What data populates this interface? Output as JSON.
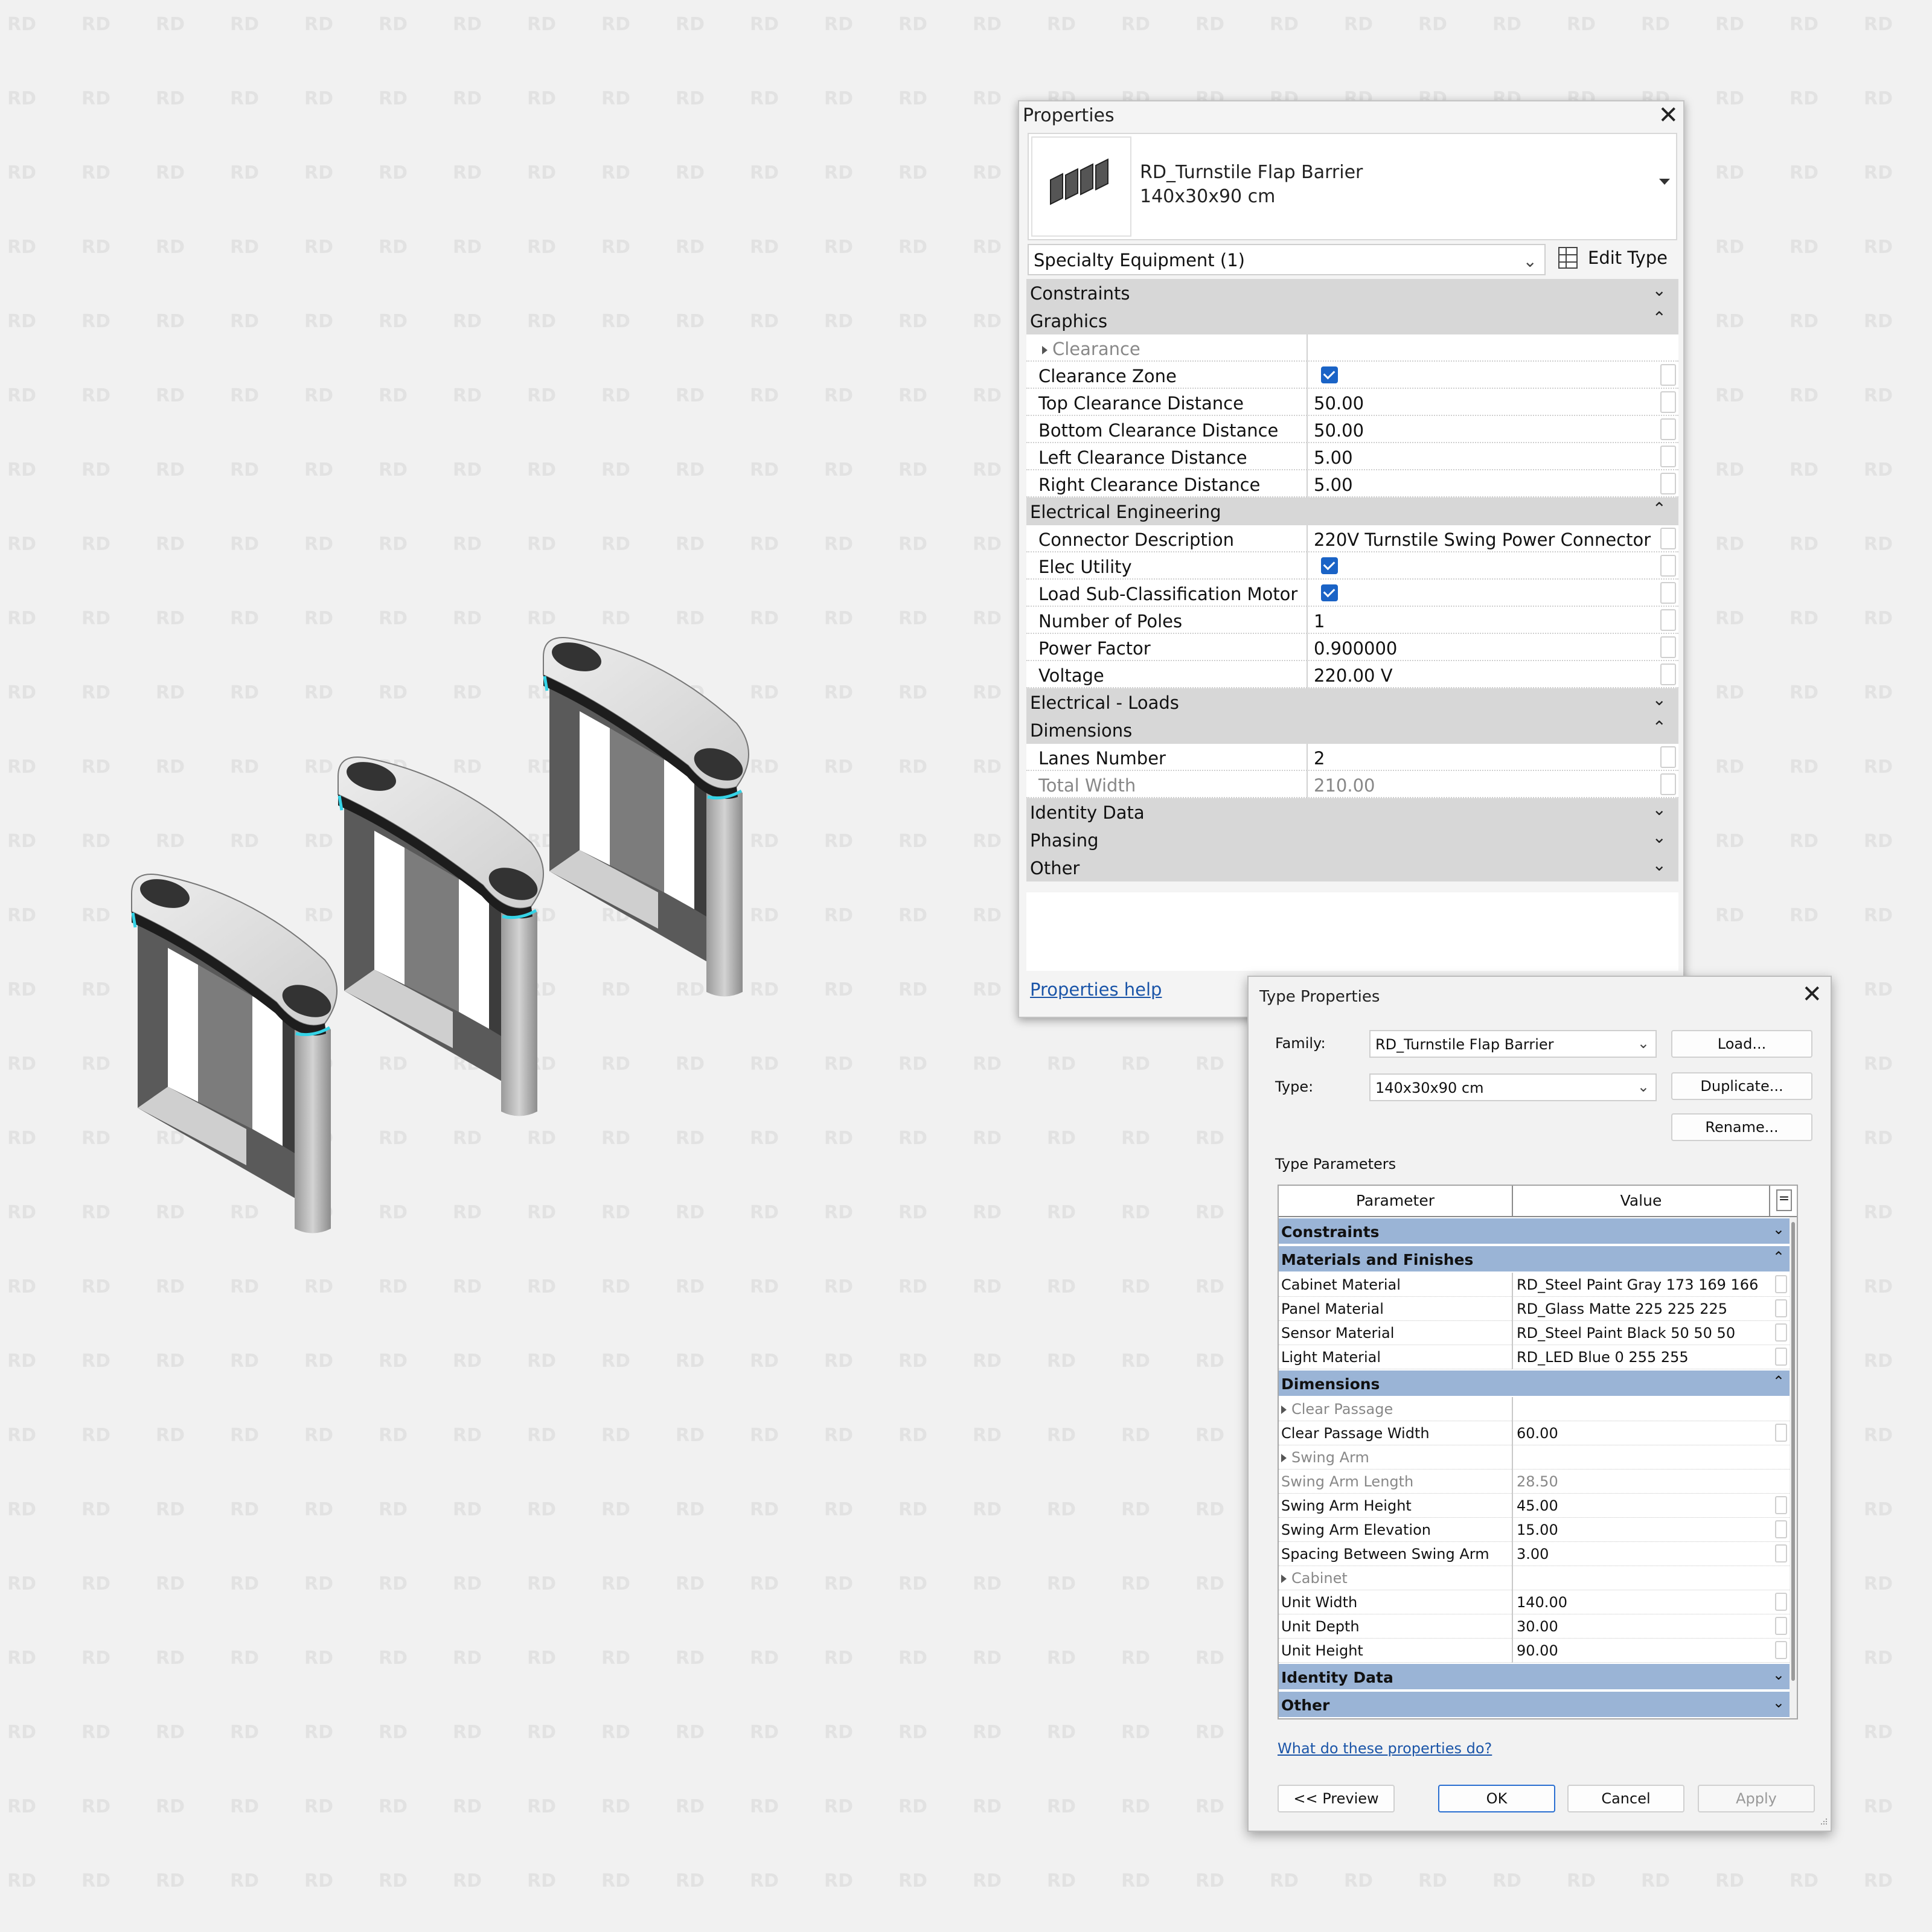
{
  "watermark": "RD",
  "colors": {
    "accent": "#1a63c6",
    "group_blue": "#9ab4d6",
    "link": "#1b55a8",
    "led": "#35d3e6"
  },
  "properties": {
    "title": "Properties",
    "type_name": "RD_Turnstile Flap Barrier",
    "type_size": "140x30x90 cm",
    "instance_filter": "Specialty Equipment (1)",
    "edit_type": "Edit Type",
    "help_link": "Properties help",
    "groups": {
      "constraints": "Constraints",
      "graphics": "Graphics",
      "electrical_engineering": "Electrical Engineering",
      "electrical_loads": "Electrical - Loads",
      "dimensions": "Dimensions",
      "identity_data": "Identity Data",
      "phasing": "Phasing",
      "other": "Other"
    },
    "params": {
      "clearance": {
        "name": "Clearance"
      },
      "clearance_zone": {
        "name": "Clearance Zone",
        "checked": true
      },
      "top_clearance": {
        "name": "Top Clearance Distance",
        "value": "50.00"
      },
      "bottom_clearance": {
        "name": "Bottom Clearance Distance",
        "value": "50.00"
      },
      "left_clearance": {
        "name": "Left Clearance Distance",
        "value": "5.00"
      },
      "right_clearance": {
        "name": "Right Clearance Distance",
        "value": "5.00"
      },
      "connector_desc": {
        "name": "Connector Description",
        "value": "220V Turnstile Swing Power Connector"
      },
      "elec_utility": {
        "name": "Elec Utility",
        "checked": true
      },
      "load_sub_motor": {
        "name": "Load Sub-Classification Motor",
        "checked": true
      },
      "num_poles": {
        "name": "Number of Poles",
        "value": "1"
      },
      "power_factor": {
        "name": "Power Factor",
        "value": "0.900000"
      },
      "voltage": {
        "name": "Voltage",
        "value": "220.00 V"
      },
      "lanes_number": {
        "name": "Lanes Number",
        "value": "2"
      },
      "total_width": {
        "name": "Total Width",
        "value": "210.00"
      }
    }
  },
  "type_properties": {
    "title": "Type Properties",
    "family_label": "Family:",
    "family_value": "RD_Turnstile Flap Barrier",
    "type_label": "Type:",
    "type_value": "140x30x90 cm",
    "load_btn": "Load...",
    "duplicate_btn": "Duplicate...",
    "rename_btn": "Rename...",
    "type_params_label": "Type Parameters",
    "col_parameter": "Parameter",
    "col_value": "Value",
    "col_eq": "=",
    "groups": {
      "constraints": "Constraints",
      "materials": "Materials and Finishes",
      "dimensions": "Dimensions",
      "identity_data": "Identity Data",
      "other": "Other"
    },
    "params": {
      "cabinet_material": {
        "name": "Cabinet Material",
        "value": "RD_Steel Paint Gray 173 169 166"
      },
      "panel_material": {
        "name": "Panel Material",
        "value": "RD_Glass Matte 225 225 225"
      },
      "sensor_material": {
        "name": "Sensor Material",
        "value": "RD_Steel Paint Black 50 50 50"
      },
      "light_material": {
        "name": "Light Material",
        "value": "RD_LED Blue 0 255 255"
      },
      "clear_passage": {
        "name": "Clear Passage"
      },
      "clear_passage_width": {
        "name": "Clear Passage Width",
        "value": "60.00"
      },
      "swing_arm": {
        "name": "Swing Arm"
      },
      "swing_arm_length": {
        "name": "Swing Arm Length",
        "value": "28.50"
      },
      "swing_arm_height": {
        "name": "Swing Arm Height",
        "value": "45.00"
      },
      "swing_arm_elevation": {
        "name": "Swing Arm Elevation",
        "value": "15.00"
      },
      "spacing_between": {
        "name": "Spacing Between Swing Arm",
        "value": "3.00"
      },
      "cabinet": {
        "name": "Cabinet"
      },
      "unit_width": {
        "name": "Unit Width",
        "value": "140.00"
      },
      "unit_depth": {
        "name": "Unit Depth",
        "value": "30.00"
      },
      "unit_height": {
        "name": "Unit Height",
        "value": "90.00"
      }
    },
    "help_link": "What do these properties do?",
    "preview_btn": "<< Preview",
    "ok_btn": "OK",
    "cancel_btn": "Cancel",
    "apply_btn": "Apply"
  }
}
